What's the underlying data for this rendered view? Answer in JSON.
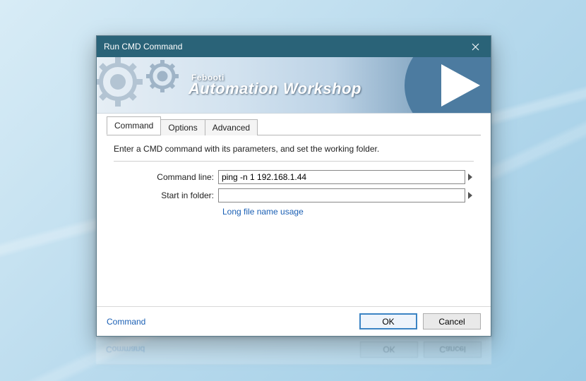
{
  "window": {
    "title": "Run CMD Command"
  },
  "banner": {
    "subtitle": "Febooti",
    "title": "Automation Workshop"
  },
  "tabs": [
    {
      "label": "Command",
      "active": true
    },
    {
      "label": "Options",
      "active": false
    },
    {
      "label": "Advanced",
      "active": false
    }
  ],
  "panel": {
    "instruction": "Enter a CMD command with its parameters, and set the working folder.",
    "command_line_label": "Command line:",
    "command_line_value": "ping -n 1 192.168.1.44",
    "start_in_label": "Start in folder:",
    "start_in_value": "",
    "link_text": "Long file name usage"
  },
  "footer": {
    "status_link": "Command",
    "ok_label": "OK",
    "cancel_label": "Cancel"
  }
}
